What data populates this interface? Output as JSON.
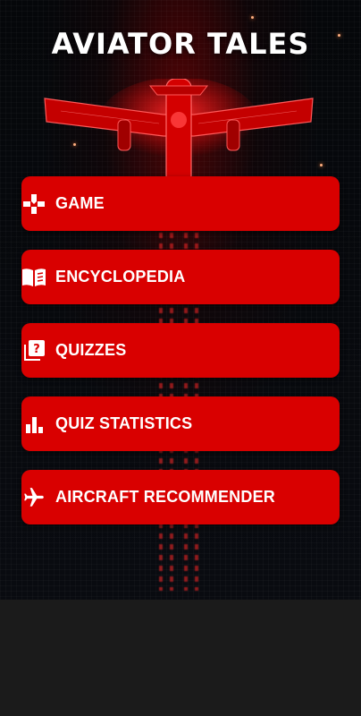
{
  "app": {
    "title": "AVIATOR TALES"
  },
  "menu": {
    "items": [
      {
        "label": "GAME",
        "icon": "gamepad-icon"
      },
      {
        "label": "ENCYCLOPEDIA",
        "icon": "book-icon"
      },
      {
        "label": "QUIZZES",
        "icon": "quiz-icon"
      },
      {
        "label": "QUIZ STATISTICS",
        "icon": "bar-chart-icon"
      },
      {
        "label": "AIRCRAFT RECOMMENDER",
        "icon": "airplane-icon"
      }
    ]
  },
  "colors": {
    "button_red": "#d90000",
    "text": "#ffffff",
    "background": "#05070a",
    "bottom_panel": "#1b1b1b"
  }
}
